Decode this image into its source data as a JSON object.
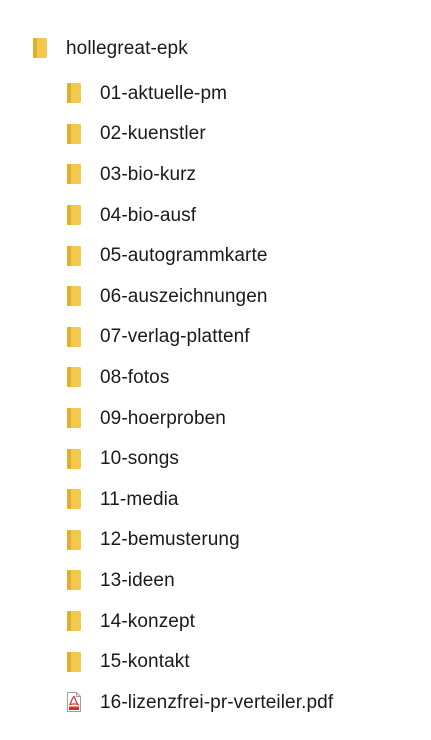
{
  "colors": {
    "folder": "#F2C94C",
    "folder_shade": "#E0AE2E",
    "pdf_red": "#D32F2F"
  },
  "root": {
    "label": "hollegreat-epk",
    "icon": "folder-icon"
  },
  "items": [
    {
      "label": "01-aktuelle-pm",
      "icon": "folder-icon"
    },
    {
      "label": "02-kuenstler",
      "icon": "folder-icon"
    },
    {
      "label": "03-bio-kurz",
      "icon": "folder-icon"
    },
    {
      "label": "04-bio-ausf",
      "icon": "folder-icon"
    },
    {
      "label": "05-autogrammkarte",
      "icon": "folder-icon"
    },
    {
      "label": "06-auszeichnungen",
      "icon": "folder-icon"
    },
    {
      "label": "07-verlag-plattenf",
      "icon": "folder-icon"
    },
    {
      "label": "08-fotos",
      "icon": "folder-icon"
    },
    {
      "label": "09-hoerproben",
      "icon": "folder-icon"
    },
    {
      "label": "10-songs",
      "icon": "folder-icon"
    },
    {
      "label": "11-media",
      "icon": "folder-icon"
    },
    {
      "label": "12-bemusterung",
      "icon": "folder-icon"
    },
    {
      "label": "13-ideen",
      "icon": "folder-icon"
    },
    {
      "label": "14-konzept",
      "icon": "folder-icon"
    },
    {
      "label": "15-kontakt",
      "icon": "folder-icon"
    },
    {
      "label": "16-lizenzfrei-pr-verteiler.pdf",
      "icon": "pdf-icon"
    }
  ]
}
